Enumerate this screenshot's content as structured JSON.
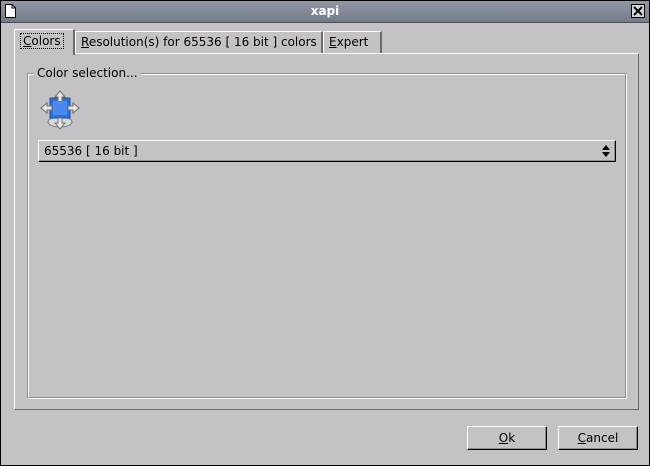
{
  "window": {
    "title": "xapi"
  },
  "tabs": [
    {
      "mnemonic": "C",
      "rest": "olors",
      "active": true
    },
    {
      "mnemonic": "R",
      "rest": "esolution(s) for 65536 [ 16 bit ] colors",
      "active": false
    },
    {
      "mnemonic": "E",
      "rest": "xpert",
      "active": false
    }
  ],
  "color_selection": {
    "label": "Color selection...",
    "icon": "display-settings-icon",
    "selected_value": "65536 [ 16 bit ]"
  },
  "buttons": {
    "ok": {
      "mnemonic": "O",
      "rest": "k"
    },
    "cancel": {
      "mnemonic": "C",
      "rest": "ancel"
    }
  },
  "colors": {
    "window_bg": "#c5c2c5",
    "titlebar": "#838a98",
    "icon_blue": "#2f6fd6"
  }
}
